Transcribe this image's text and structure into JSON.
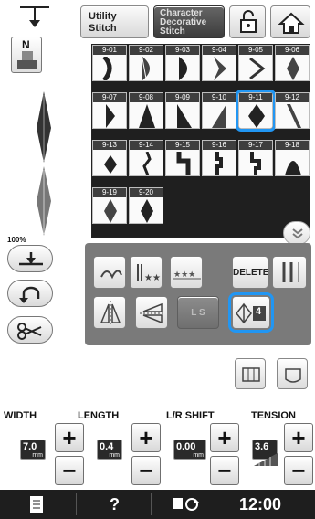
{
  "tabs": {
    "utility": [
      "Utility",
      "Stitch"
    ],
    "character": [
      "Character",
      "Decorative",
      "Stitch"
    ]
  },
  "left_panel": {
    "foot_letter": "N",
    "zoom": "100%"
  },
  "stitch_grid": {
    "rows": [
      [
        "9-01",
        "9-02",
        "9-03",
        "9-04",
        "9-05",
        "9-06"
      ],
      [
        "9-07",
        "9-08",
        "9-09",
        "9-10",
        "9-11",
        "9-12"
      ],
      [
        "9-13",
        "9-14",
        "9-15",
        "9-16",
        "9-17",
        "9-18"
      ],
      [
        "9-19",
        "9-20"
      ]
    ],
    "selected": "9-11"
  },
  "controls": {
    "delete_label": "DELETE",
    "ls_label": "L S",
    "density_value": "4"
  },
  "settings": {
    "width": {
      "label": "WIDTH",
      "value": "7.0",
      "unit": "mm"
    },
    "length": {
      "label": "LENGTH",
      "value": "0.4",
      "unit": "mm"
    },
    "lr_shift": {
      "label": "L/R SHIFT",
      "value": "0.00",
      "unit": "mm"
    },
    "tension": {
      "label": "TENSION",
      "value": "3.6"
    }
  },
  "statusbar": {
    "help": "?",
    "time": "12:00"
  },
  "colors": {
    "selection": "#2196f3",
    "panel": "#7a7a7a",
    "statusbar": "#1e1e1e"
  }
}
